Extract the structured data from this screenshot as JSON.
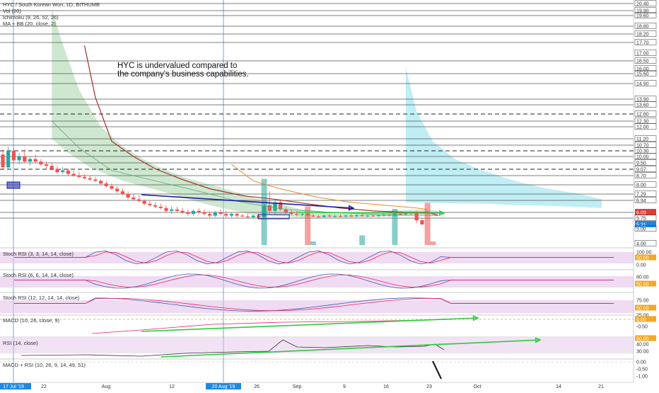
{
  "header": {
    "title": "HYC / South Korean Won, 1D, BITHUMB",
    "studies": [
      "Vol (20)",
      "Ichimoku (9, 26, 52, 26)",
      "MA + BB (20, close, 2)"
    ]
  },
  "annotation": {
    "line1": "HYC is undervalued compared to",
    "line2": "the company's business capabilities."
  },
  "panes": [
    {
      "title": "Stoch RSI (3, 3, 14, 14, close)",
      "ticks": [
        "100.00",
        "50.00",
        "0.00"
      ]
    },
    {
      "title": "Stoch RSI (6, 6, 14, 14, close)",
      "ticks": [
        "80.00",
        "50.00"
      ]
    },
    {
      "title": "Stoch RSI (12, 12, 14, 14, close)",
      "ticks": [
        "75.00",
        "50.00",
        "25.00"
      ]
    },
    {
      "title": "MACD (10, 26, close, 9)",
      "ticks": [
        "0.00",
        "-0.50"
      ]
    },
    {
      "title": "RSI (14, close)",
      "ticks": [
        "50.00",
        "40.00",
        "30.00"
      ]
    },
    {
      "title": "MACD + RSI (10, 26, 9, 14, 49, 51)",
      "ticks": [
        "0.00",
        "-0.50",
        "-1.00"
      ]
    }
  ],
  "chart_data": {
    "type": "candlestick",
    "symbol": "HYC",
    "quote_currency": "South Korean Won",
    "interval": "1D",
    "exchange": "BITHUMB",
    "price_ticks": [
      "20.40",
      "19.90",
      "19.60",
      "18.80",
      "18.20",
      "17.70",
      "17.00",
      "16.50",
      "16.00",
      "15.60",
      "14.90",
      "13.90",
      "13.60",
      "12.80",
      "12.30",
      "12.00",
      "11.20",
      "10.70",
      "10.30",
      "10.00",
      "9.50",
      "9.07",
      "8.70",
      "8.00",
      "7.29",
      "6.94",
      "6.09",
      "5.75",
      "5.31",
      "5.00",
      "4.00"
    ],
    "price_highlights": [
      {
        "label": "6.09",
        "color": "#e53935"
      },
      {
        "label": "5.31",
        "color": "#1e88e5"
      }
    ],
    "horizontal_levels": [
      20.4,
      19.9,
      19.6,
      18.8,
      18.2,
      17.7,
      16.5,
      15.6,
      14.9,
      13.9,
      13.6,
      12.8,
      12.3,
      12.0,
      11.2,
      10.7,
      10.3,
      10.0,
      9.5,
      9.07,
      8.7,
      8.0,
      7.29,
      6.94,
      6.09,
      5.75
    ],
    "dashed_levels": [
      12.8,
      10.3,
      9.07
    ],
    "x_ticks": [
      "17 Jul '19",
      "22",
      "Aug",
      "12",
      "20 Aug '19",
      "26",
      "Sep",
      "9",
      "16",
      "23",
      "Oct",
      "14",
      "21"
    ],
    "highlighted_dates": [
      "17 Jul '19",
      "20 Aug '19"
    ],
    "trend_arrows": [
      {
        "pane": "price",
        "color": "#1a1aa6"
      },
      {
        "pane": "price",
        "color": "#2ecc40"
      },
      {
        "pane": "MACD",
        "color": "#2ecc40"
      },
      {
        "pane": "RSI",
        "color": "#2ecc40"
      }
    ],
    "colors": {
      "up": "#26a69a",
      "down": "#ef5350",
      "tenkan": "#a0302a",
      "kijun_ma": "#e68a2e",
      "cloud_green": "#a5d6a7",
      "cloud_cyan": "#80deea",
      "band": "#e1bee7",
      "stoch_k": "#3f51b5",
      "stoch_d": "#e91e63"
    }
  }
}
